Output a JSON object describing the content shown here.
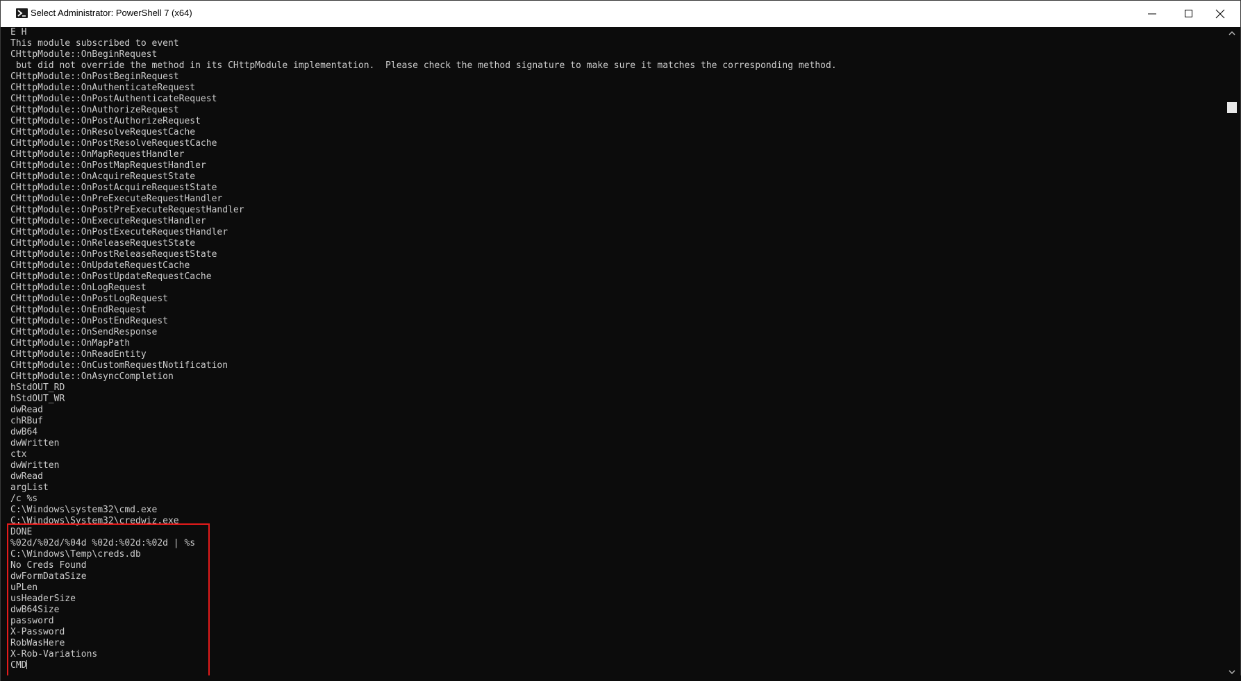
{
  "window": {
    "title": "Select Administrator: PowerShell 7 (x64)"
  },
  "colors": {
    "console_bg": "#0c0c0c",
    "console_text": "#cccccc",
    "highlight_border": "#e41b1b",
    "titlebar_bg": "#ffffff"
  },
  "icons": {
    "app": "powershell-icon",
    "minimize": "minimize-icon",
    "maximize": "maximize-icon",
    "close": "close-icon"
  },
  "console": {
    "lines": [
      "E H",
      "This module subscribed to event",
      "CHttpModule::OnBeginRequest",
      " but did not override the method in its CHttpModule implementation.  Please check the method signature to make sure it matches the corresponding method.",
      "CHttpModule::OnPostBeginRequest",
      "CHttpModule::OnAuthenticateRequest",
      "CHttpModule::OnPostAuthenticateRequest",
      "CHttpModule::OnAuthorizeRequest",
      "CHttpModule::OnPostAuthorizeRequest",
      "CHttpModule::OnResolveRequestCache",
      "CHttpModule::OnPostResolveRequestCache",
      "CHttpModule::OnMapRequestHandler",
      "CHttpModule::OnPostMapRequestHandler",
      "CHttpModule::OnAcquireRequestState",
      "CHttpModule::OnPostAcquireRequestState",
      "CHttpModule::OnPreExecuteRequestHandler",
      "CHttpModule::OnPostPreExecuteRequestHandler",
      "CHttpModule::OnExecuteRequestHandler",
      "CHttpModule::OnPostExecuteRequestHandler",
      "CHttpModule::OnReleaseRequestState",
      "CHttpModule::OnPostReleaseRequestState",
      "CHttpModule::OnUpdateRequestCache",
      "CHttpModule::OnPostUpdateRequestCache",
      "CHttpModule::OnLogRequest",
      "CHttpModule::OnPostLogRequest",
      "CHttpModule::OnEndRequest",
      "CHttpModule::OnPostEndRequest",
      "CHttpModule::OnSendResponse",
      "CHttpModule::OnMapPath",
      "CHttpModule::OnReadEntity",
      "CHttpModule::OnCustomRequestNotification",
      "CHttpModule::OnAsyncCompletion",
      "hStdOUT_RD",
      "hStdOUT_WR",
      "dwRead",
      "chRBuf",
      "dwB64",
      "dwWritten",
      "ctx",
      "dwWritten",
      "dwRead",
      "argList",
      "/c %s",
      "C:\\Windows\\system32\\cmd.exe",
      "C:\\Windows\\System32\\credwiz.exe",
      "DONE",
      "%02d/%02d/%04d %02d:%02d:%02d | %s",
      "C:\\Windows\\Temp\\creds.db",
      "No Creds Found",
      "dwFormDataSize",
      "uPLen",
      "usHeaderSize",
      "dwB64Size",
      "password",
      "X-Password",
      "RobWasHere",
      "X-Rob-Variations",
      "CMD"
    ]
  }
}
